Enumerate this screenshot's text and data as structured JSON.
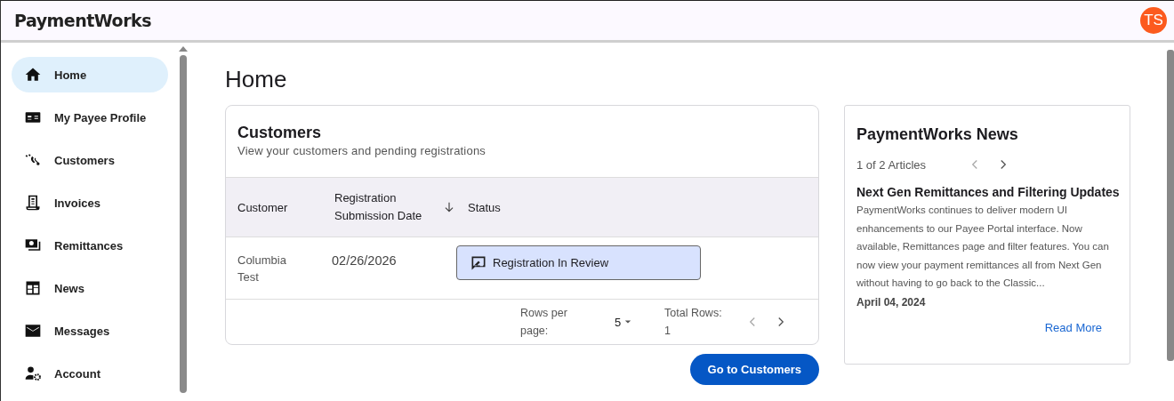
{
  "header": {
    "logo": "PaymentWorks",
    "avatar": "TS"
  },
  "sidebar": {
    "items": [
      {
        "label": "Home",
        "selected": true
      },
      {
        "label": "My Payee Profile",
        "selected": false
      },
      {
        "label": "Customers",
        "selected": false
      },
      {
        "label": "Invoices",
        "selected": false
      },
      {
        "label": "Remittances",
        "selected": false
      },
      {
        "label": "News",
        "selected": false
      },
      {
        "label": "Messages",
        "selected": false
      },
      {
        "label": "Account",
        "selected": false
      }
    ]
  },
  "page_title": "Home",
  "customers": {
    "title": "Customers",
    "subtitle": "View your customers and pending registrations",
    "columns": [
      "Customer",
      "Registration Submission Date",
      "Status"
    ],
    "rows": [
      {
        "customer": "Columbia Test",
        "date": "02/26/2026",
        "status": "Registration In Review"
      }
    ],
    "rows_per_page_label": "Rows per page:",
    "rows_per_page": "5",
    "total_rows_label": "Total Rows:",
    "total_rows": "1",
    "button": "Go to Customers"
  },
  "news": {
    "title": "PaymentWorks News",
    "counter": "1 of 2 Articles",
    "article_title": "Next Gen Remittances and Filtering Updates",
    "article_body": "PaymentWorks continues to deliver modern UI enhancements to our Payee Portal interface. Now available, Remittances page and filter features. You can now view your payment remittances all from Next Gen without having to go back to the Classic...",
    "date": "April 04, 2024",
    "link": "Read More"
  }
}
